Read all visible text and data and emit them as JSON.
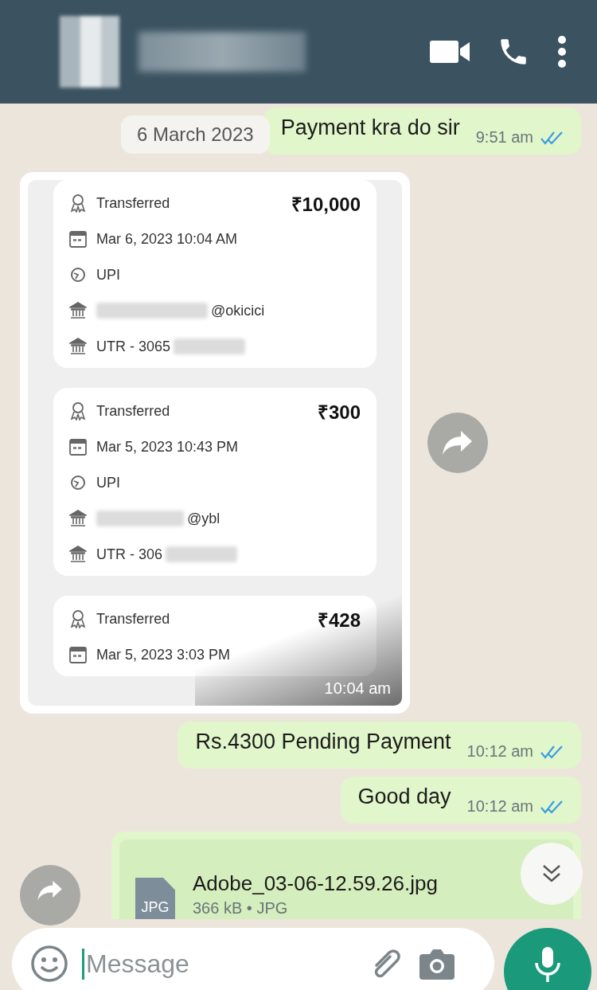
{
  "date_chip": "6 March 2023",
  "messages": [
    {
      "kind": "text",
      "text": "Payment kra do sir",
      "time": "9:51 am",
      "read": true
    },
    {
      "kind": "receipts",
      "time": "10:04 am",
      "receipts": [
        {
          "status": "Transferred",
          "amount": "₹10,000",
          "datetime": "Mar 6, 2023 10:04 AM",
          "method": "UPI",
          "account": "@okicici",
          "utr": "UTR - 3065"
        },
        {
          "status": "Transferred",
          "amount": "₹300",
          "datetime": "Mar 5, 2023 10:43 PM",
          "method": "UPI",
          "account": "@ybl",
          "utr": "UTR - 306"
        },
        {
          "status": "Transferred",
          "amount": "₹428",
          "datetime": "Mar 5, 2023 3:03 PM"
        }
      ]
    },
    {
      "kind": "text",
      "text": "Rs.4300 Pending Payment",
      "time": "10:12 am",
      "read": true
    },
    {
      "kind": "text",
      "text": "Good day",
      "time": "10:12 am",
      "read": true
    },
    {
      "kind": "document",
      "filename": "Adobe_03-06-12.59.26.jpg",
      "meta": "366 kB • JPG",
      "type_label": "JPG"
    }
  ],
  "composer": {
    "placeholder": "Message"
  }
}
